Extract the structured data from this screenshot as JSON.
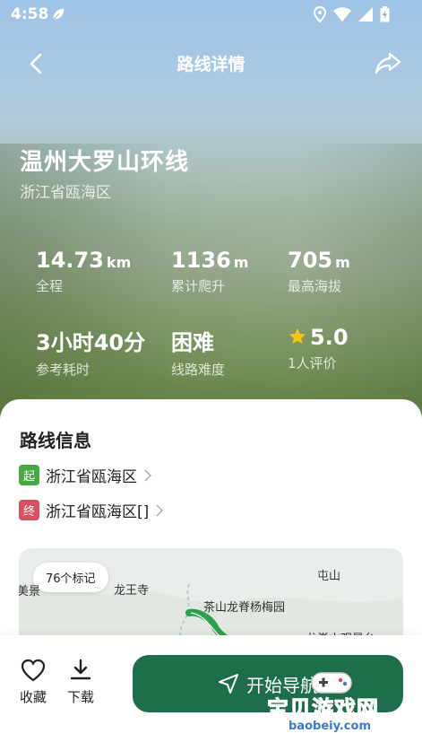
{
  "status_bar": {
    "time": "4:58"
  },
  "header": {
    "title": "路线详情"
  },
  "route": {
    "name": "温州大罗山环线",
    "region": "浙江省瓯海区"
  },
  "stats": [
    {
      "value": "14.73",
      "unit": "km",
      "label": "全程"
    },
    {
      "value": "1136",
      "unit": "m",
      "label": "累计爬升"
    },
    {
      "value": "705",
      "unit": "m",
      "label": "最高海拔"
    },
    {
      "value": "3小时40分",
      "unit": "",
      "label": "参考耗时"
    },
    {
      "value": "困难",
      "unit": "",
      "label": "线路难度"
    },
    {
      "value": "5.0",
      "unit": "",
      "label": "1人评价"
    }
  ],
  "info": {
    "title": "路线信息",
    "start_badge": "起",
    "start": "浙江省瓯海区",
    "end_badge": "终",
    "end": "浙江省瓯海区[]"
  },
  "map": {
    "markers_label": "76个标记",
    "labels": [
      "龙王寺",
      "屯山",
      "茶山龙脊杨梅园",
      "龙脊山观景台"
    ]
  },
  "bottom": {
    "favorite_label": "收藏",
    "download_label": "下载",
    "navigate_label": "开始导航"
  },
  "watermark": {
    "text": "宝贝游戏网",
    "url": "baobeiy.com"
  },
  "colors": {
    "primary": "#1e6e4c",
    "start": "#47a846",
    "end": "#d94f5e",
    "star": "#f5c518"
  }
}
